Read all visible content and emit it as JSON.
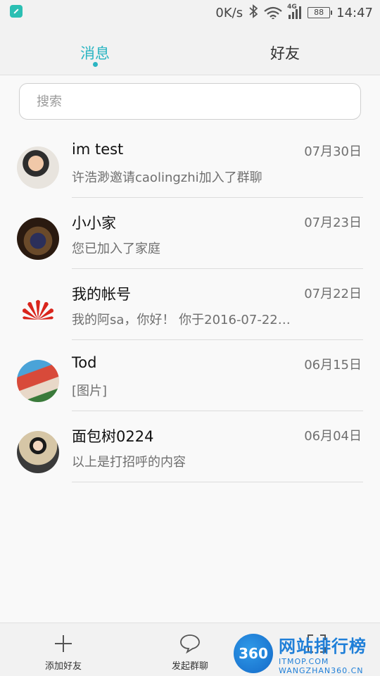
{
  "status_bar": {
    "speed": "0K/s",
    "network": "4G",
    "battery": "88",
    "time": "14:47"
  },
  "tabs": [
    {
      "label": "消息",
      "active": true
    },
    {
      "label": "好友",
      "active": false
    }
  ],
  "search": {
    "placeholder": "搜索"
  },
  "conversations": [
    {
      "name": "im test",
      "message": "许浩渺邀请caolingzhi加入了群聊",
      "date": "07月30日"
    },
    {
      "name": "小小家",
      "message": "您已加入了家庭",
      "date": "07月23日"
    },
    {
      "name": "我的帐号",
      "message": "我的阿sa，你好！ 你于2016-07-22…",
      "date": "07月22日"
    },
    {
      "name": "Tod",
      "message": "[图片]",
      "date": "06月15日"
    },
    {
      "name": "面包树0224",
      "message": "以上是打招呼的内容",
      "date": "06月04日"
    }
  ],
  "toolbar": {
    "add_friend": "添加好友",
    "start_group_chat": "发起群聊"
  },
  "watermark": {
    "logo": "360",
    "title": "网站排行榜",
    "subtitle": "WANGZHAN360.CN",
    "overlay": "ITMOP.COM"
  },
  "colors": {
    "accent": "#2bb5c2",
    "huawei_red": "#d9251c"
  }
}
